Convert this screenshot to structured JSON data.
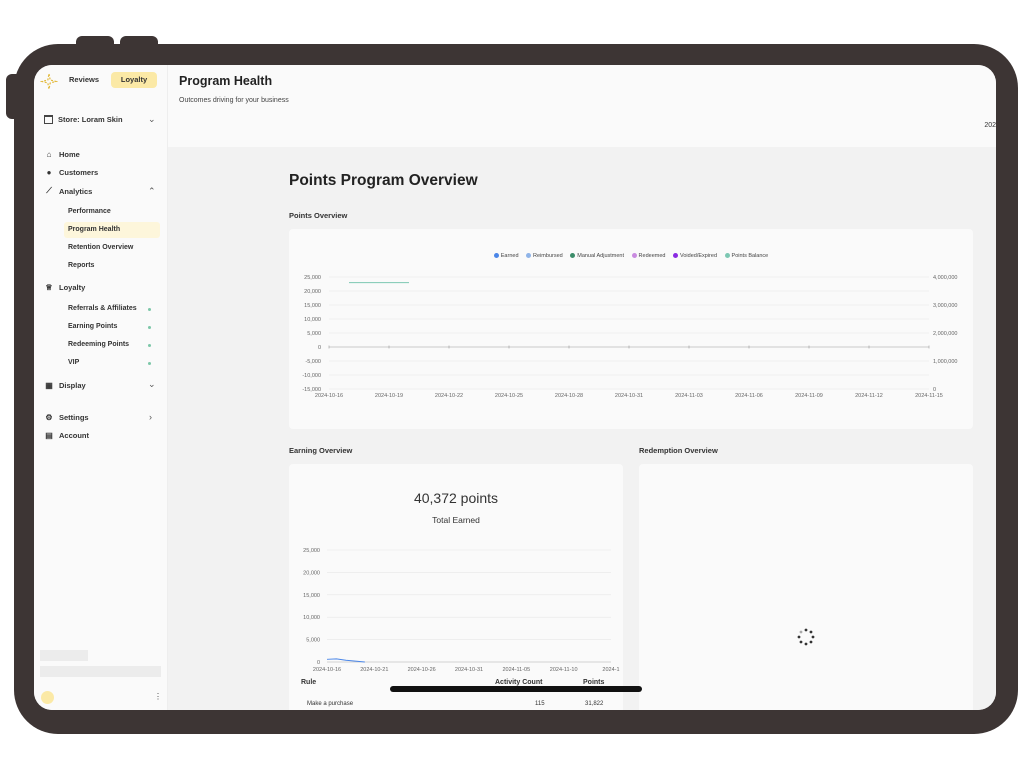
{
  "sidebar": {
    "toggle": {
      "reviews": "Reviews",
      "loyalty": "Loyalty",
      "selected": "Loyalty"
    },
    "store": "Store: Loram Skin",
    "nav": {
      "home": "Home",
      "customers": "Customers",
      "analytics": "Analytics",
      "analytics_items": [
        "Performance",
        "Program Health",
        "Retention Overview",
        "Reports"
      ],
      "loyalty": "Loyalty",
      "loyalty_items": [
        "Referrals & Affiliates",
        "Earning Points",
        "Redeeming Points",
        "VIP"
      ],
      "display": "Display",
      "settings": "Settings",
      "account": "Account"
    },
    "active_item": "Program Health"
  },
  "header": {
    "title": "Program Health",
    "subtitle": "Outcomes driving for your business",
    "right_cut_text": "202"
  },
  "main": {
    "title": "Points Program Overview",
    "points_overview_label": "Points Overview",
    "earning_overview_label": "Earning Overview",
    "redemption_overview_label": "Redemption Overview",
    "total_earned_value": "40,372 points",
    "total_earned_label": "Total Earned",
    "table": {
      "headers": [
        "Rule",
        "Activity Count",
        "Points"
      ],
      "rows": [
        [
          "Make a purchase",
          "115",
          "31,822"
        ]
      ]
    }
  },
  "colors": {
    "accent": "#fbe9a6",
    "earned": "#4a86e8",
    "reimbursed": "#8fb4e8",
    "manual_adjustment": "#3c8d6a",
    "redeemed": "#c98be0",
    "voided_expired": "#8a2be2",
    "points_balance": "#7cc7b2"
  },
  "chart_data": [
    {
      "type": "line",
      "title": "Points Overview",
      "legend": [
        "Earned",
        "Reimbursed",
        "Manual Adjustment",
        "Redeemed",
        "Voided/Expired",
        "Points Balance"
      ],
      "legend_placement": "top",
      "x_ticks": [
        "2024-10-16",
        "2024-10-19",
        "2024-10-22",
        "2024-10-25",
        "2024-10-28",
        "2024-10-31",
        "2024-11-03",
        "2024-11-06",
        "2024-11-09",
        "2024-11-12",
        "2024-11-15"
      ],
      "y_left_ticks": [
        "25,000",
        "20,000",
        "15,000",
        "10,000",
        "5,000",
        "0",
        "-5,000",
        "-10,000",
        "-15,000"
      ],
      "y_right_ticks": [
        "4,000,000",
        "3,000,000",
        "2,000,000",
        "1,000,000",
        "0"
      ],
      "ylim_left": [
        -15000,
        25000
      ],
      "ylim_right": [
        0,
        4000000
      ],
      "grid": true,
      "series": [
        {
          "name": "Points Balance",
          "axis": "right",
          "x": [
            "2024-10-17",
            "2024-10-18",
            "2024-10-19",
            "2024-10-20"
          ],
          "values": [
            3800000,
            3800000,
            3800000,
            3800000
          ]
        }
      ]
    },
    {
      "type": "line",
      "title": "Earning Overview",
      "x_ticks": [
        "2024-10-16",
        "2024-10-21",
        "2024-10-26",
        "2024-10-31",
        "2024-11-05",
        "2024-11-10",
        "2024-1"
      ],
      "y_ticks": [
        "25,000",
        "20,000",
        "15,000",
        "10,000",
        "5,000",
        "0"
      ],
      "ylim": [
        0,
        25000
      ],
      "grid": true,
      "series": [
        {
          "name": "Earned",
          "x": [
            "2024-10-16",
            "2024-10-17",
            "2024-10-18",
            "2024-10-19",
            "2024-10-20"
          ],
          "values": [
            600,
            700,
            400,
            200,
            0
          ]
        }
      ]
    }
  ]
}
